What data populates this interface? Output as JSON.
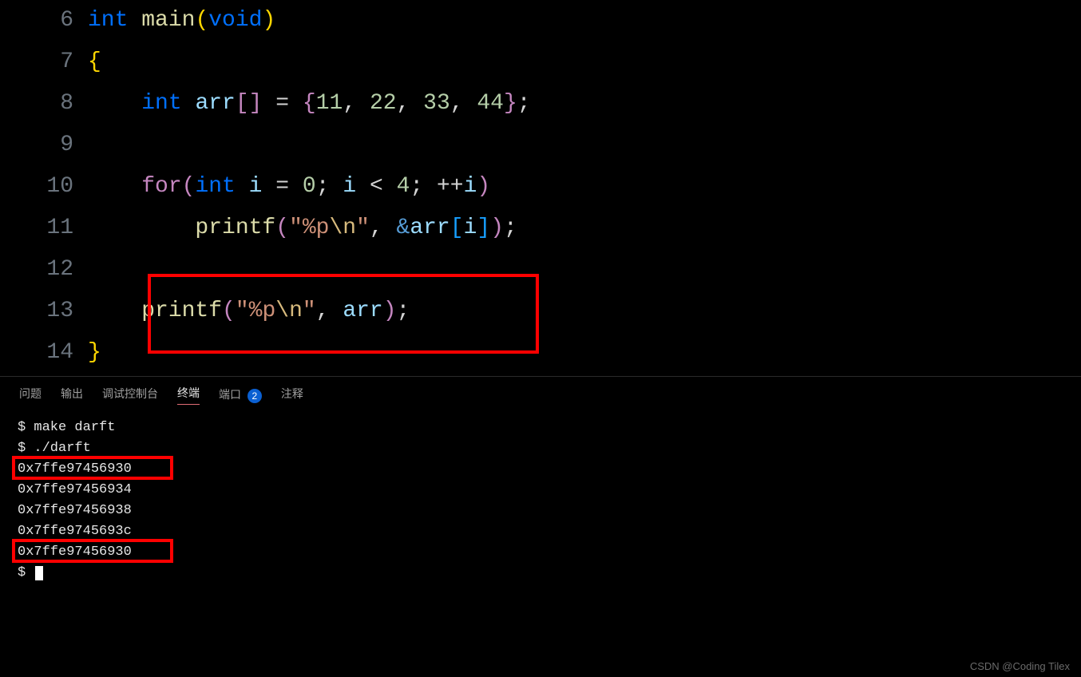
{
  "editor": {
    "lines": [
      {
        "num": "6",
        "tokens": [
          {
            "t": "int ",
            "c": "kw"
          },
          {
            "t": "main",
            "c": "fn"
          },
          {
            "t": "(",
            "c": "parY"
          },
          {
            "t": "void",
            "c": "kw"
          },
          {
            "t": ")",
            "c": "parY"
          }
        ]
      },
      {
        "num": "7",
        "tokens": [
          {
            "t": "{",
            "c": "parY"
          }
        ]
      },
      {
        "num": "8",
        "tokens": [
          {
            "t": "    ",
            "c": "op"
          },
          {
            "t": "int ",
            "c": "kw"
          },
          {
            "t": "arr",
            "c": "var"
          },
          {
            "t": "[",
            "c": "par"
          },
          {
            "t": "]",
            "c": "par"
          },
          {
            "t": " = ",
            "c": "op"
          },
          {
            "t": "{",
            "c": "par"
          },
          {
            "t": "11",
            "c": "num"
          },
          {
            "t": ", ",
            "c": "op"
          },
          {
            "t": "22",
            "c": "num"
          },
          {
            "t": ", ",
            "c": "op"
          },
          {
            "t": "33",
            "c": "num"
          },
          {
            "t": ", ",
            "c": "op"
          },
          {
            "t": "44",
            "c": "num"
          },
          {
            "t": "}",
            "c": "par"
          },
          {
            "t": ";",
            "c": "op"
          }
        ]
      },
      {
        "num": "9",
        "tokens": []
      },
      {
        "num": "10",
        "tokens": [
          {
            "t": "    ",
            "c": "op"
          },
          {
            "t": "for",
            "c": "par"
          },
          {
            "t": "(",
            "c": "par"
          },
          {
            "t": "int ",
            "c": "kw"
          },
          {
            "t": "i",
            "c": "var"
          },
          {
            "t": " = ",
            "c": "op"
          },
          {
            "t": "0",
            "c": "num"
          },
          {
            "t": "; ",
            "c": "op"
          },
          {
            "t": "i",
            "c": "var"
          },
          {
            "t": " < ",
            "c": "op"
          },
          {
            "t": "4",
            "c": "num"
          },
          {
            "t": "; ",
            "c": "op"
          },
          {
            "t": "++",
            "c": "op"
          },
          {
            "t": "i",
            "c": "var"
          },
          {
            "t": ")",
            "c": "par"
          }
        ]
      },
      {
        "num": "11",
        "tokens": [
          {
            "t": "        ",
            "c": "op"
          },
          {
            "t": "printf",
            "c": "fn"
          },
          {
            "t": "(",
            "c": "par"
          },
          {
            "t": "\"",
            "c": "str"
          },
          {
            "t": "%p",
            "c": "str"
          },
          {
            "t": "\\n",
            "c": "esc"
          },
          {
            "t": "\"",
            "c": "str"
          },
          {
            "t": ", ",
            "c": "op"
          },
          {
            "t": "&",
            "c": "ptr"
          },
          {
            "t": "arr",
            "c": "var"
          },
          {
            "t": "[",
            "c": "parB"
          },
          {
            "t": "i",
            "c": "var"
          },
          {
            "t": "]",
            "c": "parB"
          },
          {
            "t": ")",
            "c": "par"
          },
          {
            "t": ";",
            "c": "op"
          }
        ]
      },
      {
        "num": "12",
        "tokens": []
      },
      {
        "num": "13",
        "tokens": [
          {
            "t": "    ",
            "c": "op"
          },
          {
            "t": "printf",
            "c": "fn"
          },
          {
            "t": "(",
            "c": "par"
          },
          {
            "t": "\"",
            "c": "str"
          },
          {
            "t": "%p",
            "c": "str"
          },
          {
            "t": "\\n",
            "c": "esc"
          },
          {
            "t": "\"",
            "c": "str"
          },
          {
            "t": ", ",
            "c": "op"
          },
          {
            "t": "arr",
            "c": "var"
          },
          {
            "t": ")",
            "c": "par"
          },
          {
            "t": ";",
            "c": "op"
          }
        ]
      },
      {
        "num": "14",
        "tokens": [
          {
            "t": "}",
            "c": "parY"
          }
        ]
      }
    ]
  },
  "panel": {
    "tabs": {
      "problems": "问题",
      "output": "输出",
      "debug_console": "调试控制台",
      "terminal": "终端",
      "ports": "端口",
      "ports_badge": "2",
      "comments": "注释"
    }
  },
  "terminal": {
    "lines": [
      "$ make darft",
      "$ ./darft",
      "0x7ffe97456930",
      "0x7ffe97456934",
      "0x7ffe97456938",
      "0x7ffe9745693c",
      "0x7ffe97456930",
      "$ "
    ]
  },
  "watermark": "CSDN @Coding Tilex"
}
